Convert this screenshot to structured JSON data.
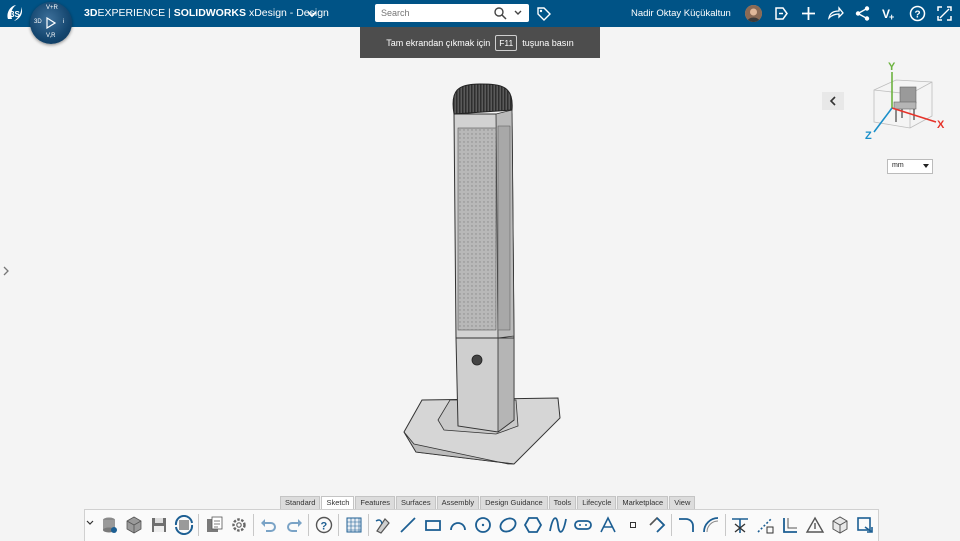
{
  "colors": {
    "topbar": "#005386",
    "toast": "#4d4d4d",
    "icon_blue": "#1d5f93",
    "axis_x": "#e6332a",
    "axis_y": "#6cb33f",
    "axis_z": "#1a8fc9"
  },
  "header": {
    "brand_bold_1": "3D",
    "brand_1": "EXPERIENCE",
    "brand_sep": " | ",
    "brand_bold_2": "SOLIDWORKS",
    "brand_2": " xDesign - Design",
    "search_placeholder": "Search",
    "user_name": "Nadir Oktay Küçükaltun",
    "icons": [
      "ds-logo-icon",
      "compass-icon",
      "chevron-down-icon",
      "search-icon",
      "tag-icon",
      "share-icon",
      "plus-icon",
      "forward-icon",
      "network-icon",
      "tools-icon",
      "help-icon",
      "fullscreen-icon"
    ]
  },
  "compass": {
    "north": "V+R",
    "south": "V,R",
    "west": "3D",
    "east": "i"
  },
  "toast": {
    "before": "Tam ekrandan çıkmak için",
    "key": "F11",
    "after": "tuşuna basın"
  },
  "viewport": {
    "units": "mm",
    "axes": {
      "x": "X",
      "y": "Y",
      "z": "Z"
    }
  },
  "tabs": [
    "Standard",
    "Sketch",
    "Features",
    "Surfaces",
    "Assembly",
    "Design Guidance",
    "Tools",
    "Lifecycle",
    "Marketplace",
    "View"
  ],
  "active_tab": "Sketch",
  "toolbar_icons": [
    "expand-icon",
    "database-icon",
    "cube-open-icon",
    "save-icon",
    "refresh-cube-icon",
    "clipboard-icon",
    "gear-icon",
    "undo-icon",
    "redo-icon",
    "help-icon",
    "grid-plane-icon",
    "sketch-pen-icon",
    "line-icon",
    "rectangle-icon",
    "arc-icon",
    "circle-icon",
    "ellipse-icon",
    "polygon-icon",
    "spline-icon",
    "slot-icon",
    "text-icon",
    "point-icon",
    "fillet-icon",
    "offset-icon",
    "arc-tangent-icon",
    "trim-icon",
    "construction-icon",
    "mirror-icon",
    "dimension-icon",
    "surface-icon",
    "cube-icon",
    "convert-icon"
  ]
}
